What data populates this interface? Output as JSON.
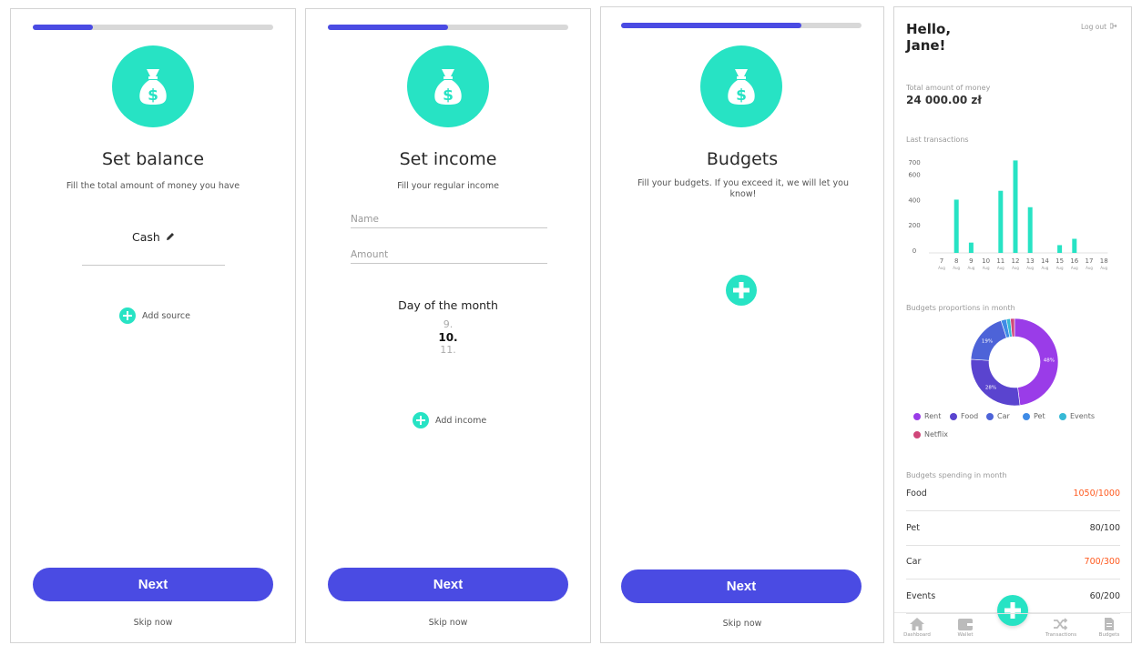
{
  "colors": {
    "accent": "#4a4be3",
    "teal": "#27e3c4",
    "over": "#ff5a1f"
  },
  "screen1": {
    "progress": 0.25,
    "icon": "money-bag-icon",
    "title": "Set balance",
    "subtitle": "Fill the total amount of money you have",
    "source_name": "Cash",
    "add_source": "Add source",
    "next": "Next",
    "skip": "Skip now"
  },
  "screen2": {
    "progress": 0.5,
    "icon": "money-bag-icon",
    "title": "Set income",
    "subtitle": "Fill your regular income",
    "name_placeholder": "Name",
    "amount_placeholder": "Amount",
    "day_label": "Day of the month",
    "day_prev": "9.",
    "day_selected": "10.",
    "day_next": "11.",
    "add_income": "Add income",
    "next": "Next",
    "skip": "Skip now"
  },
  "screen3": {
    "progress": 0.75,
    "icon": "money-bag-icon",
    "title": "Budgets",
    "subtitle": "Fill your budgets. If you exceed it, we will let you know!",
    "next": "Next",
    "skip": "Skip now"
  },
  "dashboard": {
    "greeting": "Hello,\nJane!",
    "logout": "Log out",
    "total_label": "Total amount of money",
    "total_value": "24 000.00 zł",
    "last_transactions_label": "Last transactions",
    "budgets_proportions_label": "Budgets proportions in month",
    "budgets_spending_label": "Budgets spending in month",
    "budgets": [
      {
        "name": "Food",
        "value": "1050/1000",
        "over": true
      },
      {
        "name": "Pet",
        "value": "80/100",
        "over": false
      },
      {
        "name": "Car",
        "value": "700/300",
        "over": true
      },
      {
        "name": "Events",
        "value": "60/200",
        "over": false
      }
    ],
    "tabs": [
      "Dashboard",
      "Wallet",
      "Transactions",
      "Budgets"
    ]
  },
  "chart_data": [
    {
      "type": "bar",
      "categories": [
        "7",
        "8",
        "9",
        "10",
        "11",
        "12",
        "13",
        "14",
        "15",
        "16",
        "17",
        "18"
      ],
      "category_sublabels": [
        "Aug",
        "Aug",
        "Aug",
        "Aug",
        "Aug",
        "Aug",
        "Aug",
        "Aug",
        "Aug",
        "Aug",
        "Aug",
        "Aug"
      ],
      "values": [
        0,
        400,
        60,
        0,
        470,
        710,
        340,
        0,
        40,
        90,
        0,
        0
      ],
      "yticks": [
        0,
        200,
        400,
        600,
        700
      ],
      "ylim": [
        0,
        720
      ],
      "grid": false,
      "color": "#27e3c4"
    },
    {
      "type": "pie",
      "slices": [
        {
          "name": "Rent",
          "value": 48,
          "color": "#9a3ce8"
        },
        {
          "name": "Food",
          "value": 28,
          "color": "#5a44cf"
        },
        {
          "name": "Car",
          "value": 19,
          "color": "#4d63d8"
        },
        {
          "name": "Pet",
          "value": 2,
          "color": "#3f8be6"
        },
        {
          "name": "Events",
          "value": 1.5,
          "color": "#37b9d6"
        },
        {
          "name": "Netflix",
          "value": 1.5,
          "color": "#d0477a"
        }
      ],
      "slice_labels": [
        "48%",
        "28%",
        "19%"
      ],
      "donut": true,
      "legend": "bottom"
    }
  ]
}
